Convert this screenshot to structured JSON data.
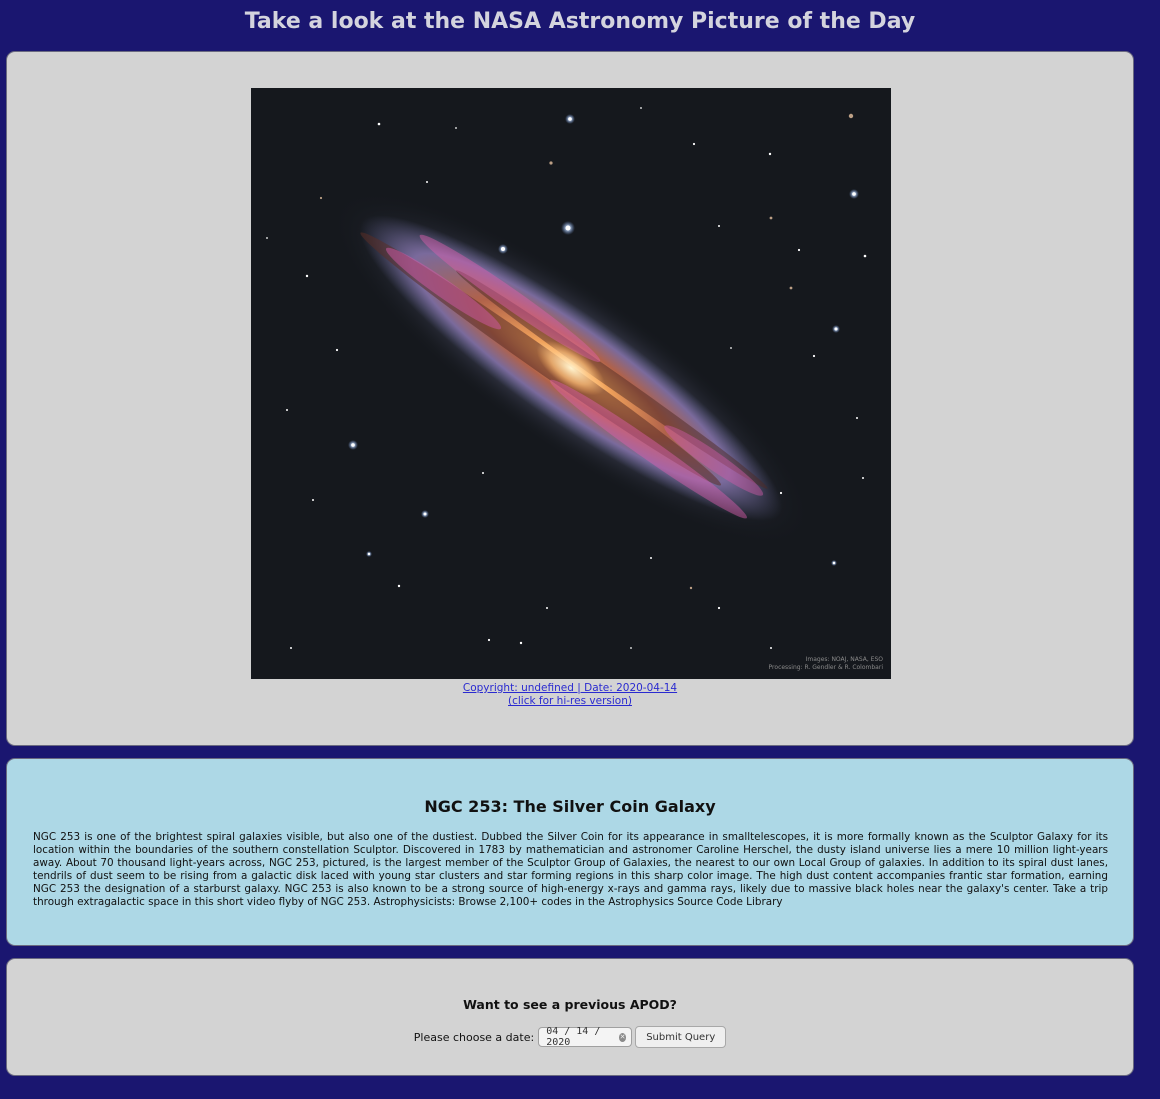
{
  "header": {
    "title": "Take a look at the NASA Astronomy Picture of the Day"
  },
  "apod_image": {
    "alt": "NGC 253: The Silver Coin Galaxy",
    "credit_lines": [
      "Images: NOAJ, NASA, ESO",
      "Processing: R. Gendler & R. Colombari"
    ]
  },
  "caption": {
    "copyright_link": "Copyright: undefined | Date: 2020-04-14",
    "hires_link": "(click for hi-res version)"
  },
  "apod": {
    "title": "NGC 253: The Silver Coin Galaxy",
    "explanation": "NGC 253 is one of the brightest spiral galaxies visible, but also one of the dustiest. Dubbed the Silver Coin for its appearance in smalltelescopes, it is more formally known as the Sculptor Galaxy for its location within the boundaries of the southern constellation Sculptor. Discovered in 1783 by mathematician and astronomer Caroline Herschel, the dusty island universe lies a mere 10 million light-years away. About 70 thousand light-years across, NGC 253, pictured, is the largest member of the Sculptor Group of Galaxies, the nearest to our own Local Group of galaxies. In addition to its spiral dust lanes, tendrils of dust seem to be rising from a galactic disk laced with young star clusters and star forming regions in this sharp color image. The high dust content accompanies frantic star formation, earning NGC 253 the designation of a starburst galaxy. NGC 253 is also known to be a strong source of high-energy x-rays and gamma rays, likely due to massive black holes near the galaxy's center. Take a trip through extragalactic space in this short video flyby of NGC 253. Astrophysicists: Browse 2,100+ codes in the Astrophysics Source Code Library"
  },
  "form": {
    "heading": "Want to see a previous APOD?",
    "date_label": "Please choose a date:",
    "date_value": "04 / 14 / 2020",
    "submit_label": "Submit Query"
  },
  "icons": {
    "clear": "clear-icon"
  },
  "colors": {
    "page_background": "#1a1670",
    "image_panel": "#d3d3d3",
    "text_panel": "#add8e6",
    "link": "#2a2ad0"
  }
}
